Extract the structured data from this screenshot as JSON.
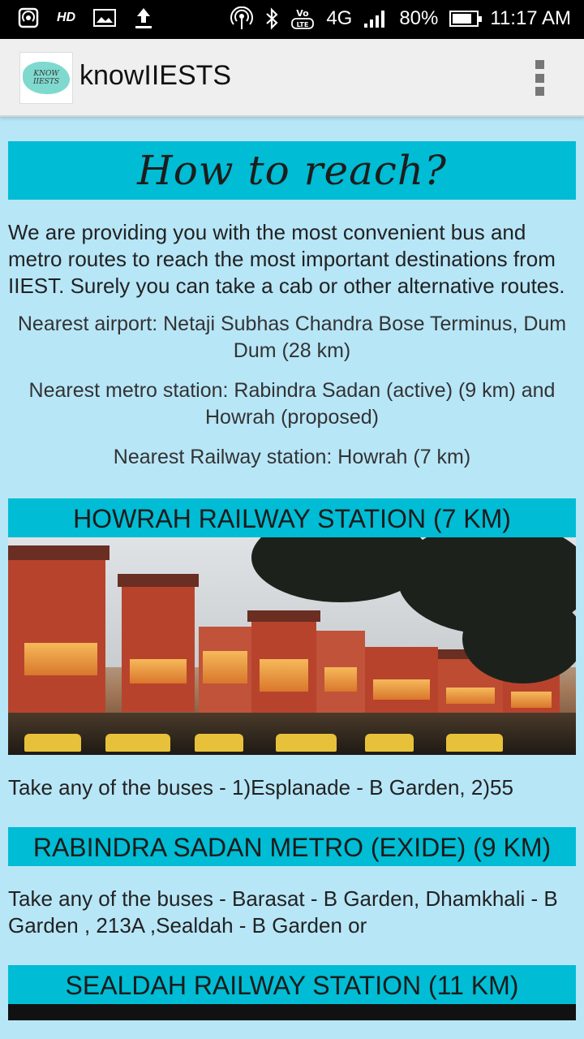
{
  "status_bar": {
    "hd": "HD",
    "network": "4G",
    "battery": "80%",
    "battery_level": 0.8,
    "time": "11:17 AM",
    "icons": [
      "hotspot-icon",
      "image-icon",
      "upload-icon",
      "wifi-broadcast-icon",
      "bluetooth-icon",
      "volte-icon",
      "signal-icon",
      "battery-icon"
    ]
  },
  "app_bar": {
    "logo_text": "KNOW IIESTS",
    "title": "knowIIESTS",
    "menu_icon": "overflow-menu-icon"
  },
  "page": {
    "heading": "How to reach?",
    "intro": "We are providing you with the most convenient bus and metro routes to reach the most important destinations from IIEST. Surely you can take a cab or other alternative routes.",
    "nearest_airport": "Nearest airport: Netaji Subhas Chandra Bose Terminus, Dum Dum (28 km)",
    "nearest_metro": "Nearest metro station: Rabindra Sadan (active) (9 km) and Howrah (proposed)",
    "nearest_railway": "Nearest Railway station: Howrah (7 km)"
  },
  "sections": [
    {
      "title": "HOWRAH RAILWAY STATION (7 KM)",
      "has_image": true,
      "buses": "Take any of the buses - 1)Esplanade - B Garden, 2)55"
    },
    {
      "title": "RABINDRA SADAN METRO (EXIDE) (9 KM)",
      "buses": "Take any of the buses - Barasat - B Garden, Dhamkhali - B Garden , 213A ,Sealdah - B Garden or"
    },
    {
      "title": "SEALDAH RAILWAY STATION (11 KM)"
    }
  ],
  "colors": {
    "background": "#b7e6f7",
    "accent": "#00bcd4",
    "app_bar": "#efefef",
    "status_bar": "#000000"
  }
}
